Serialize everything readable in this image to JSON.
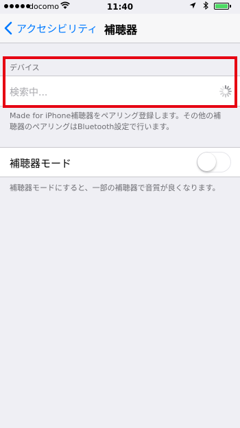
{
  "status_bar": {
    "carrier": "docomo",
    "time": "11:40",
    "signal_bars": 5,
    "battery_level": 1.0,
    "icons": [
      "signal-dots-icon",
      "wifi-icon",
      "location-arrow-icon",
      "bluetooth-icon",
      "battery-icon"
    ]
  },
  "nav": {
    "back_label": "アクセシビリティ",
    "title": "補聴器"
  },
  "devices": {
    "header": "デバイス",
    "searching": "検索中...",
    "footer_line1": "Made for iPhone補聴器をペアリング登録します。その他の補",
    "footer_line2": "聴器のペアリングはBluetooth設定で行います。"
  },
  "hearing_mode": {
    "label": "補聴器モード",
    "enabled": false,
    "note": "補聴器モードにすると、一部の補聴器で音質が良くなります。"
  },
  "colors": {
    "accent": "#007aff",
    "highlight": "#e60012",
    "background": "#efeff4",
    "battery": "#4cd964"
  }
}
